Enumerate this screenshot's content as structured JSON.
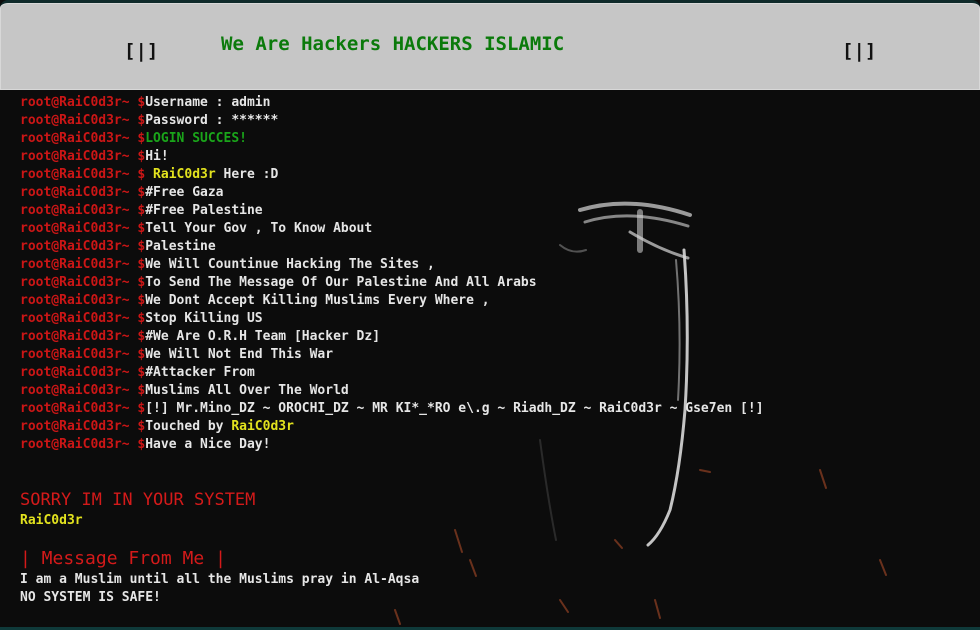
{
  "header": {
    "left_glyph": "[|]",
    "title": "We Are Hackers HACKERS ISLAMIC",
    "right_glyph": "[|]"
  },
  "prompt": "root@RaiC0d3r~ $",
  "terminal": [
    {
      "text": "Username : admin",
      "style": "white"
    },
    {
      "text": "Password : ******",
      "style": "white"
    },
    {
      "text": "LOGIN SUCCES!",
      "style": "green"
    },
    {
      "text": "Hi!",
      "style": "white"
    },
    {
      "segments": [
        {
          "text": " RaiC0d3r",
          "style": "yellow"
        },
        {
          "text": " Here :D",
          "style": "white"
        }
      ]
    },
    {
      "text": "#Free Gaza",
      "style": "white"
    },
    {
      "text": "#Free Palestine",
      "style": "white"
    },
    {
      "text": "Tell Your Gov , To Know About",
      "style": "white"
    },
    {
      "text": "Palestine",
      "style": "white"
    },
    {
      "text": "We Will Countinue Hacking The Sites ,",
      "style": "white"
    },
    {
      "text": "To Send The Message Of Our Palestine And All Arabs",
      "style": "white"
    },
    {
      "text": "We Dont Accept Killing Muslims Every Where ,",
      "style": "white"
    },
    {
      "text": "Stop Killing US",
      "style": "white"
    },
    {
      "text": "#We Are O.R.H Team [Hacker Dz]",
      "style": "white"
    },
    {
      "text": "We Will Not End This War",
      "style": "white"
    },
    {
      "text": "#Attacker From",
      "style": "white"
    },
    {
      "text": "Muslims All Over The World",
      "style": "white"
    },
    {
      "text": "[!] Mr.Mino_DZ ~ OROCHI_DZ ~ MR KI*_*RO e\\.g ~ Riadh_DZ ~ RaiC0d3r ~ Gse7en [!]",
      "style": "white"
    },
    {
      "segments": [
        {
          "text": "Touched by ",
          "style": "white"
        },
        {
          "text": "RaiC0d3r",
          "style": "yellow"
        }
      ]
    },
    {
      "text": "Have a Nice Day!",
      "style": "white"
    }
  ],
  "sorry": {
    "heading": "SORRY IM IN YOUR SYSTEM",
    "author": "RaiC0d3r"
  },
  "message": {
    "heading": "| Message From Me |",
    "line1": "I am a Muslim until all the Muslims pray in Al-Aqsa",
    "line2": "NO SYSTEM IS SAFE!"
  },
  "colors": {
    "prompt": "#cc1616",
    "title": "#0b7a0b",
    "success": "#1aa51a",
    "highlight": "#e2e21e",
    "alert": "#d41a1a",
    "text": "#e6e6e6",
    "header_bg": "#c6c6c6",
    "page_bg": "#0c0c0c"
  }
}
